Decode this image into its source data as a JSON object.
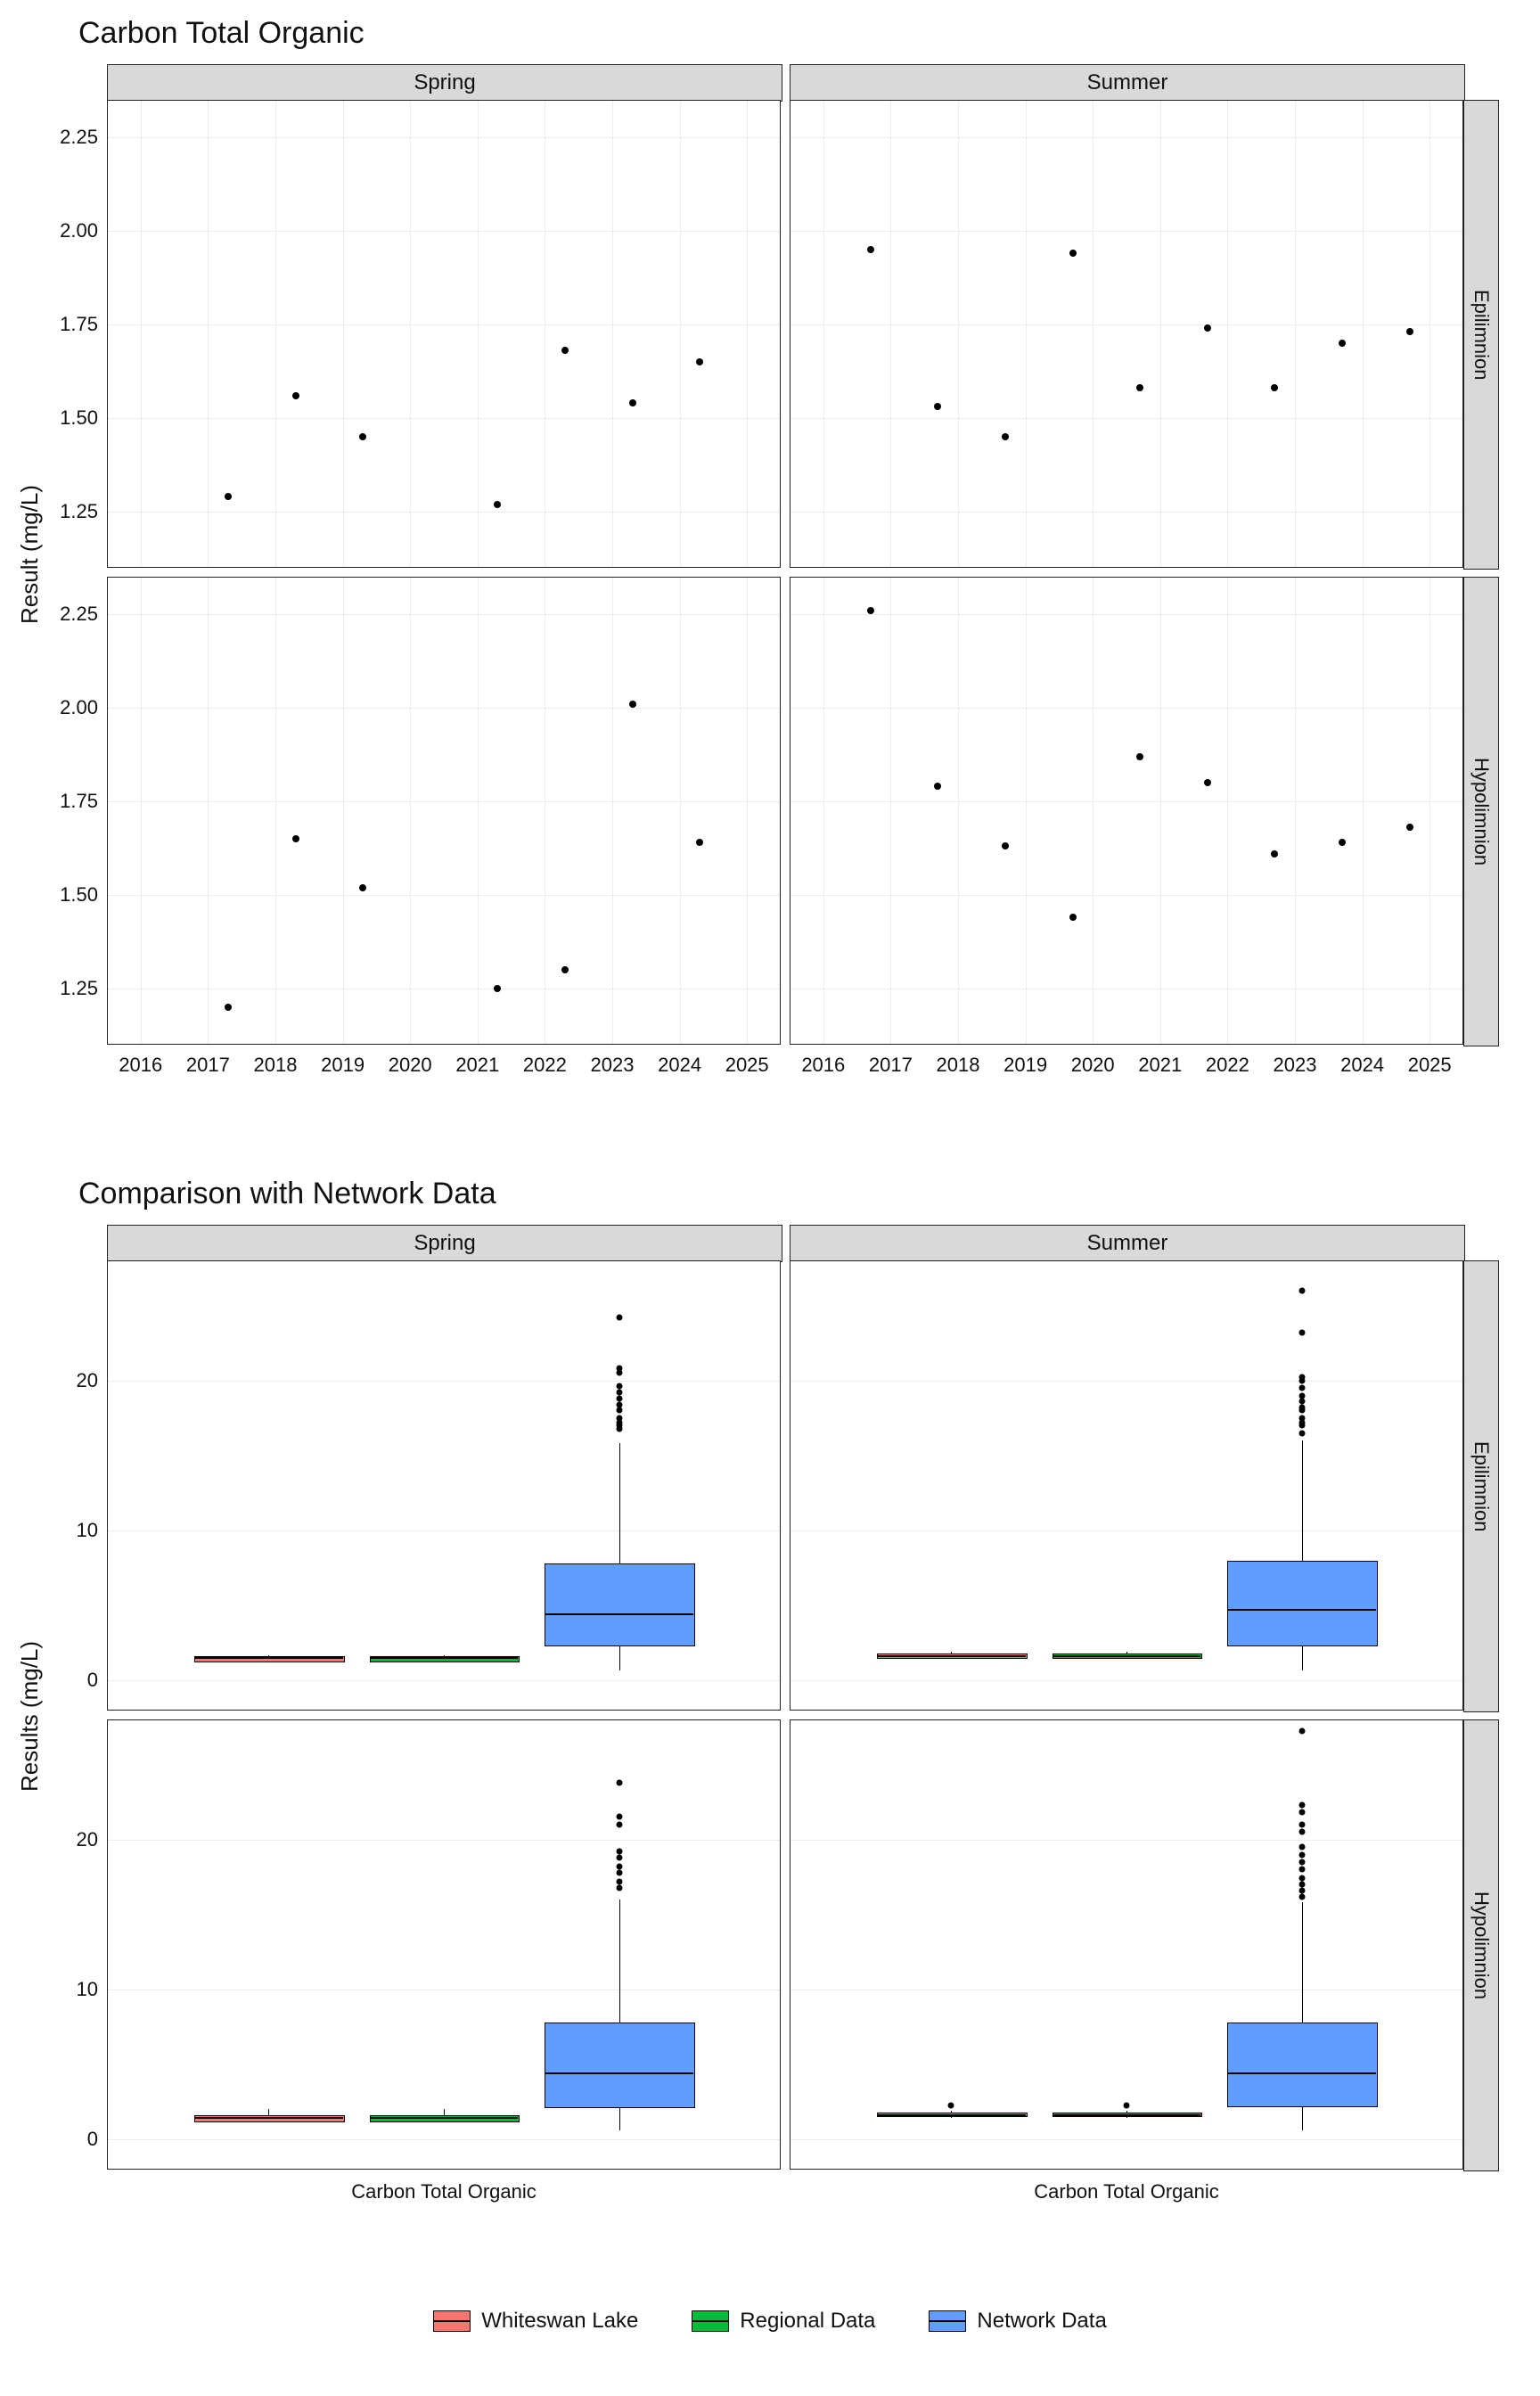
{
  "chart_data": [
    {
      "type": "scatter",
      "title": "Carbon Total Organic",
      "ylabel": "Result (mg/L)",
      "xlabel": "",
      "x_ticks": [
        2016,
        2017,
        2018,
        2019,
        2020,
        2021,
        2022,
        2023,
        2024,
        2025
      ],
      "y_ticks": [
        1.25,
        1.5,
        1.75,
        2.0,
        2.25
      ],
      "xlim": [
        2015.5,
        2025.5
      ],
      "ylim": [
        1.1,
        2.35
      ],
      "col_facets": [
        "Spring",
        "Summer"
      ],
      "row_facets": [
        "Epilimnion",
        "Hypolimnion"
      ],
      "panels": {
        "Spring_Epilimnion": [
          {
            "x": 2017.3,
            "y": 1.29
          },
          {
            "x": 2018.3,
            "y": 1.56
          },
          {
            "x": 2019.3,
            "y": 1.45
          },
          {
            "x": 2021.3,
            "y": 1.27
          },
          {
            "x": 2022.3,
            "y": 1.68
          },
          {
            "x": 2023.3,
            "y": 1.54
          },
          {
            "x": 2024.3,
            "y": 1.65
          }
        ],
        "Summer_Epilimnion": [
          {
            "x": 2016.7,
            "y": 1.95
          },
          {
            "x": 2017.7,
            "y": 1.53
          },
          {
            "x": 2018.7,
            "y": 1.45
          },
          {
            "x": 2019.7,
            "y": 1.94
          },
          {
            "x": 2020.7,
            "y": 1.58
          },
          {
            "x": 2021.7,
            "y": 1.74
          },
          {
            "x": 2022.7,
            "y": 1.58
          },
          {
            "x": 2023.7,
            "y": 1.7
          },
          {
            "x": 2024.7,
            "y": 1.73
          }
        ],
        "Spring_Hypolimnion": [
          {
            "x": 2017.3,
            "y": 1.2
          },
          {
            "x": 2018.3,
            "y": 1.65
          },
          {
            "x": 2019.3,
            "y": 1.52
          },
          {
            "x": 2021.3,
            "y": 1.25
          },
          {
            "x": 2022.3,
            "y": 1.3
          },
          {
            "x": 2023.3,
            "y": 2.01
          },
          {
            "x": 2024.3,
            "y": 1.64
          }
        ],
        "Summer_Hypolimnion": [
          {
            "x": 2016.7,
            "y": 2.26
          },
          {
            "x": 2017.7,
            "y": 1.79
          },
          {
            "x": 2018.7,
            "y": 1.63
          },
          {
            "x": 2019.7,
            "y": 1.44
          },
          {
            "x": 2020.7,
            "y": 1.87
          },
          {
            "x": 2021.7,
            "y": 1.8
          },
          {
            "x": 2022.7,
            "y": 1.61
          },
          {
            "x": 2023.7,
            "y": 1.64
          },
          {
            "x": 2024.7,
            "y": 1.68
          }
        ]
      }
    },
    {
      "type": "boxplot",
      "title": "Comparison with Network Data",
      "ylabel": "Results (mg/L)",
      "xlabel": "",
      "x_categories": [
        "Carbon Total Organic"
      ],
      "y_ticks": [
        0,
        10,
        20
      ],
      "ylim": [
        -2,
        28
      ],
      "col_facets": [
        "Spring",
        "Summer"
      ],
      "row_facets": [
        "Epilimnion",
        "Hypolimnion"
      ],
      "legend": [
        {
          "name": "Whiteswan Lake",
          "color": "#f8766d"
        },
        {
          "name": "Regional Data",
          "color": "#00ba38"
        },
        {
          "name": "Network Data",
          "color": "#619cff"
        }
      ],
      "panels": {
        "Spring_Epilimnion": {
          "boxes": [
            {
              "series": "Whiteswan Lake",
              "q1": 1.3,
              "med": 1.55,
              "q3": 1.65,
              "lw": 1.27,
              "uw": 1.68,
              "outliers": [],
              "color": "#f8766d"
            },
            {
              "series": "Regional Data",
              "q1": 1.3,
              "med": 1.55,
              "q3": 1.65,
              "lw": 1.27,
              "uw": 1.68,
              "outliers": [],
              "color": "#00ba38"
            },
            {
              "series": "Network Data",
              "q1": 2.4,
              "med": 4.5,
              "q3": 7.8,
              "lw": 0.7,
              "uw": 15.8,
              "outliers": [
                16.8,
                17.0,
                17.2,
                17.5,
                18.0,
                18.4,
                18.8,
                19.2,
                19.6,
                20.5,
                20.8,
                24.2
              ],
              "color": "#619cff"
            }
          ]
        },
        "Summer_Epilimnion": {
          "boxes": [
            {
              "series": "Whiteswan Lake",
              "q1": 1.55,
              "med": 1.7,
              "q3": 1.8,
              "lw": 1.45,
              "uw": 1.95,
              "outliers": [],
              "color": "#f8766d"
            },
            {
              "series": "Regional Data",
              "q1": 1.55,
              "med": 1.7,
              "q3": 1.8,
              "lw": 1.45,
              "uw": 1.95,
              "outliers": [],
              "color": "#00ba38"
            },
            {
              "series": "Network Data",
              "q1": 2.4,
              "med": 4.8,
              "q3": 8.0,
              "lw": 0.7,
              "uw": 16.0,
              "outliers": [
                16.5,
                17.0,
                17.2,
                17.5,
                18.0,
                18.2,
                18.6,
                19.0,
                19.5,
                20.0,
                20.2,
                23.2,
                26.0
              ],
              "color": "#619cff"
            }
          ]
        },
        "Spring_Hypolimnion": {
          "boxes": [
            {
              "series": "Whiteswan Lake",
              "q1": 1.25,
              "med": 1.52,
              "q3": 1.65,
              "lw": 1.2,
              "uw": 2.01,
              "outliers": [],
              "color": "#f8766d"
            },
            {
              "series": "Regional Data",
              "q1": 1.25,
              "med": 1.52,
              "q3": 1.65,
              "lw": 1.2,
              "uw": 2.01,
              "outliers": [],
              "color": "#00ba38"
            },
            {
              "series": "Network Data",
              "q1": 2.2,
              "med": 4.5,
              "q3": 7.8,
              "lw": 0.6,
              "uw": 16.0,
              "outliers": [
                16.8,
                17.2,
                17.8,
                18.2,
                18.8,
                19.2,
                21.0,
                21.5,
                23.8
              ],
              "color": "#619cff"
            }
          ]
        },
        "Summer_Hypolimnion": {
          "boxes": [
            {
              "series": "Whiteswan Lake",
              "q1": 1.62,
              "med": 1.7,
              "q3": 1.82,
              "lw": 1.44,
              "uw": 1.95,
              "outliers": [
                2.26
              ],
              "color": "#f8766d"
            },
            {
              "series": "Regional Data",
              "q1": 1.62,
              "med": 1.7,
              "q3": 1.82,
              "lw": 1.44,
              "uw": 1.95,
              "outliers": [
                2.26
              ],
              "color": "#00ba38"
            },
            {
              "series": "Network Data",
              "q1": 2.3,
              "med": 4.5,
              "q3": 7.8,
              "lw": 0.6,
              "uw": 15.8,
              "outliers": [
                16.2,
                16.6,
                17.0,
                17.4,
                18.0,
                18.5,
                19.0,
                19.5,
                20.5,
                21.0,
                21.8,
                22.3,
                27.2
              ],
              "color": "#619cff"
            }
          ]
        }
      }
    }
  ]
}
